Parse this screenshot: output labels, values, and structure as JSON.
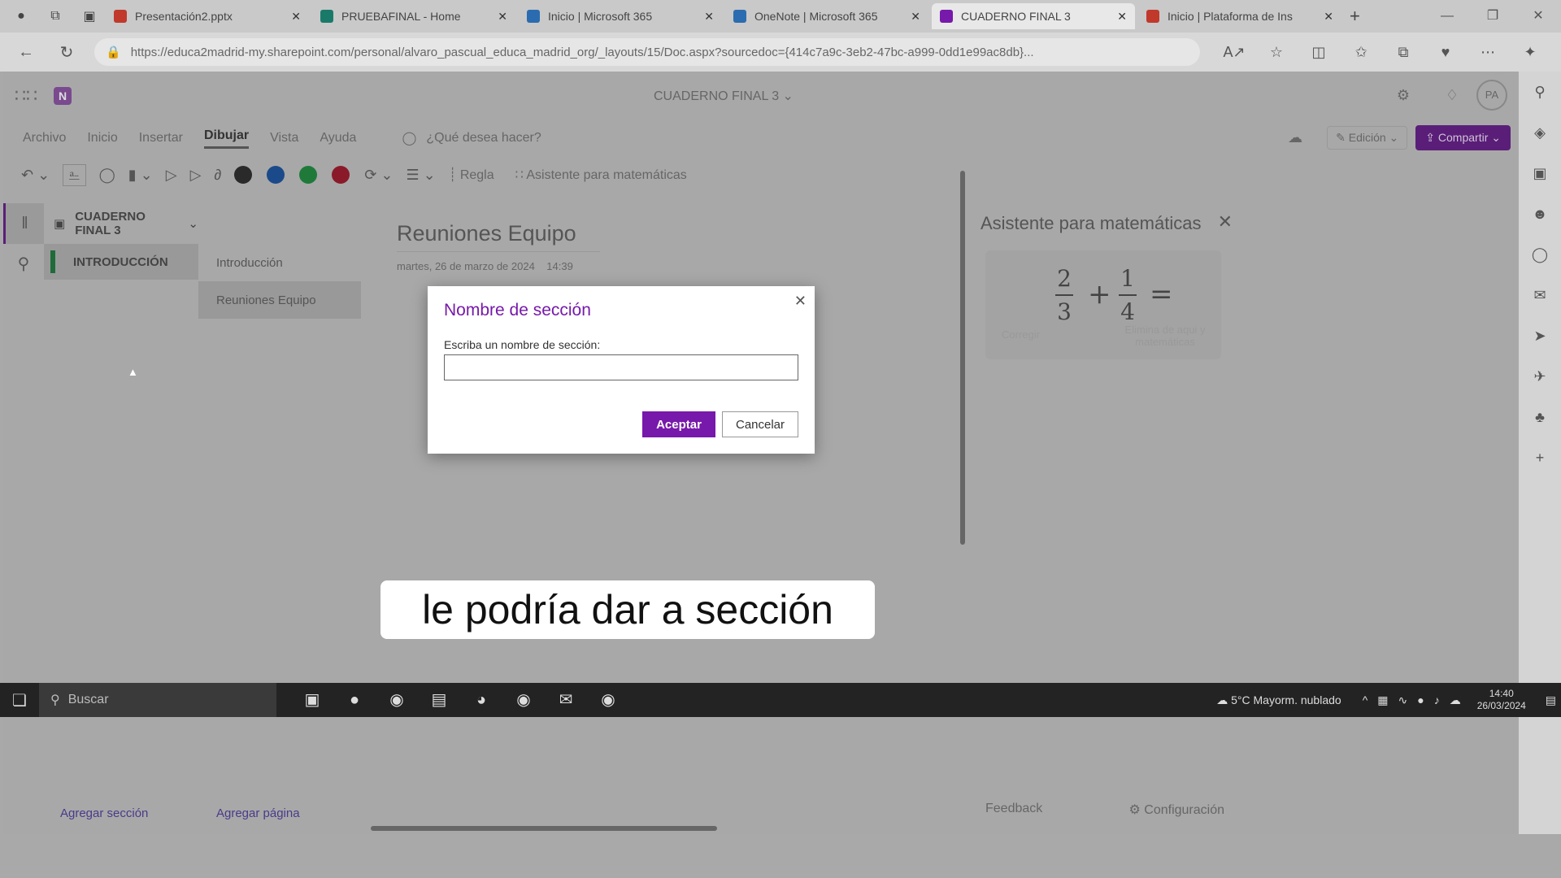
{
  "browser": {
    "tabs": [
      {
        "title": "Presentación2.pptx",
        "color": "#c0392b",
        "active": false
      },
      {
        "title": "PRUEBAFINAL - Home",
        "color": "#1a7a6a",
        "active": false
      },
      {
        "title": "Inicio | Microsoft 365",
        "color": "#2b6cb0",
        "active": false
      },
      {
        "title": "OneNote | Microsoft 365",
        "color": "#2b6cb0",
        "active": false
      },
      {
        "title": "CUADERNO FINAL 3",
        "color": "#7719aa",
        "active": true
      },
      {
        "title": "Inicio | Plataforma de Ins",
        "color": "#c0392b",
        "active": false
      }
    ],
    "url": "https://educa2madrid-my.sharepoint.com/personal/alvaro_pascual_educa_madrid_org/_layouts/15/Doc.aspx?sourcedoc={414c7a9c-3eb2-47bc-a999-0dd1e99ac8db}..."
  },
  "app": {
    "doc_title": "CUADERNO FINAL 3",
    "avatar_initials": "PA",
    "menu": [
      "Archivo",
      "Inicio",
      "Insertar",
      "Dibujar",
      "Vista",
      "Ayuda"
    ],
    "active_menu": "Dibujar",
    "tell_me": "¿Qué desea hacer?",
    "edicion": "Edición",
    "compartir": "Compartir",
    "toolbar": {
      "regla": "Regla",
      "math_assistant": "Asistente para matemáticas",
      "pen_colors": [
        "#2a2a2a",
        "#1a4a8a",
        "#1f7a3a",
        "#8a1a2a"
      ]
    }
  },
  "notebook": {
    "name": "CUADERNO FINAL 3",
    "section": "INTRODUCCIÓN",
    "pages": [
      "Introducción",
      "Reuniones Equipo"
    ],
    "active_page": "Reuniones Equipo",
    "add_section": "Agregar sección",
    "add_page": "Agregar página"
  },
  "page": {
    "title": "Reuniones Equipo",
    "date": "martes, 26 de marzo de 2024",
    "time": "14:39"
  },
  "math_pane": {
    "title": "Asistente para matemáticas",
    "fraction1": {
      "num": "2",
      "den": "3"
    },
    "fraction2": {
      "num": "1",
      "den": "4"
    },
    "plus": "+",
    "equals": "=",
    "left_label": "Corregir",
    "right_label": "Elimina de aqui y matemáticas",
    "feedback": "Feedback",
    "config": "Configuración"
  },
  "dialog": {
    "title": "Nombre de sección",
    "label": "Escriba un nombre de sección:",
    "input_value": "",
    "ok": "Aceptar",
    "cancel": "Cancelar"
  },
  "caption": "le podría dar a sección",
  "taskbar": {
    "search": "Buscar",
    "weather": "5°C  Mayorm. nublado",
    "time": "14:40",
    "date": "26/03/2024"
  }
}
